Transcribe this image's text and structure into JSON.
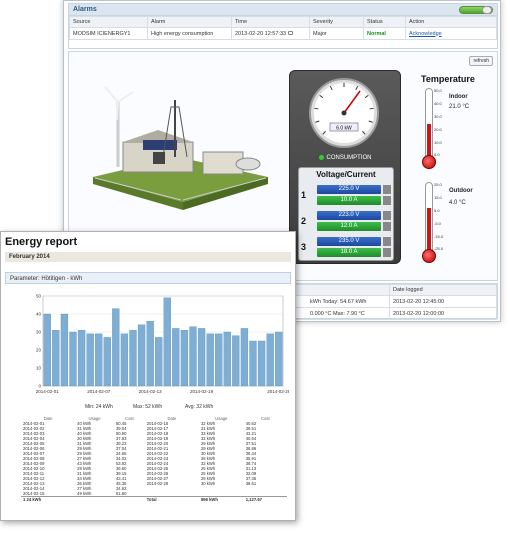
{
  "alarms": {
    "title": "Alarms",
    "columns": [
      "Source",
      "Alarm",
      "Time",
      "Severity",
      "Status",
      "Action"
    ],
    "row": {
      "source": "MODSIM ICIENERGY1",
      "alarm": "High energy consumption",
      "time": "2013-02-20 12:57:33",
      "severity": "Major",
      "status": "Normal",
      "action": "Acknowledge"
    }
  },
  "plant": {
    "refresh_label": "refresh",
    "gauge_reading": "6.0 kW",
    "consumption_label": "CONSUMPTION",
    "vc_title": "Voltage/Current",
    "phases": [
      {
        "n": "1",
        "voltage": "225.0 V",
        "current": "10.0 A"
      },
      {
        "n": "2",
        "voltage": "223.0 V",
        "current": "12.0 A"
      },
      {
        "n": "3",
        "voltage": "235.0 V",
        "current": "18.0 A"
      }
    ],
    "temperature": {
      "title": "Temperature",
      "indoor_label": "Indoor",
      "indoor_value": "21.0 °C",
      "indoor_level": 21.0,
      "outdoor_label": "Outdoor",
      "outdoor_value": "4.0 °C",
      "outdoor_level": 4.0,
      "indoor_ticks": [
        "50.0",
        "40.0",
        "30.0",
        "20.0",
        "10.0",
        "0.0"
      ],
      "outdoor_ticks": [
        "25.0",
        "15.0",
        "5.0",
        "-5.0",
        "-15.0",
        "-25.0"
      ]
    }
  },
  "logs": {
    "columns": [
      "",
      "Date logged"
    ],
    "rows": [
      {
        "value": "kWh Today: 54.67 kWh",
        "date": "2013-02-20 12:45:00"
      },
      {
        "value": "0.000 °C  Max: 7.90 °C",
        "date": "2013-02-20 12:00:00"
      }
    ]
  },
  "report": {
    "title": "Energy report",
    "subtitle": "February 2014",
    "parameter": "Parameter: Hötitigen - kWh",
    "stats": {
      "min": "Min:  24 kWh",
      "max": "Max:  52 kWh",
      "avg": "Avg:  32 kWh"
    },
    "table_headers": [
      "Date",
      "Usage",
      "Cost",
      "Date",
      "Usage",
      "Cost"
    ],
    "rows_left": [
      [
        "2014-02-01",
        "40 kWh",
        "50.45"
      ],
      [
        "2014-02-02",
        "31 kWh",
        "39.04"
      ],
      [
        "2014-02-03",
        "40 kWh",
        "50.90"
      ],
      [
        "2014-02-04",
        "30 kWh",
        "37.93"
      ],
      [
        "2014-02-05",
        "31 kWh",
        "39.23"
      ],
      [
        "2014-02-06",
        "29 kWh",
        "37.04"
      ],
      [
        "2014-02-07",
        "29 kWh",
        "34.65"
      ],
      [
        "2014-02-08",
        "27 kWh",
        "34.02"
      ],
      [
        "2014-02-09",
        "43 kWh",
        "53.92"
      ],
      [
        "2014-02-10",
        "29 kWh",
        "36.60"
      ],
      [
        "2014-02-11",
        "31 kWh",
        "39.15"
      ],
      [
        "2014-02-12",
        "34 kWh",
        "43.41"
      ],
      [
        "2014-02-13",
        "36 kWh",
        "45.36"
      ],
      [
        "2014-02-14",
        "27 kWh",
        "34.62"
      ],
      [
        "2014-02-15",
        "49 kWh",
        "61.60"
      ]
    ],
    "rows_right": [
      [
        "2014-02-16",
        "32 kWh",
        "40.62"
      ],
      [
        "2014-02-17",
        "31 kWh",
        "39.51"
      ],
      [
        "2014-02-18",
        "33 kWh",
        "42.21"
      ],
      [
        "2014-02-19",
        "32 kWh",
        "40.64"
      ],
      [
        "2014-02-20",
        "29 kWh",
        "37.51"
      ],
      [
        "2014-02-21",
        "29 kWh",
        "36.86"
      ],
      [
        "2014-02-22",
        "30 kWh",
        "38.44"
      ],
      [
        "2014-02-23",
        "28 kWh",
        "35.91"
      ],
      [
        "2014-02-24",
        "32 kWh",
        "38.74"
      ],
      [
        "2014-02-25",
        "25 kWh",
        "31.13"
      ],
      [
        "2014-02-26",
        "25 kWh",
        "32.09"
      ],
      [
        "2014-02-27",
        "29 kWh",
        "37.35"
      ],
      [
        "2014-02-28",
        "30 kWh",
        "38.61"
      ]
    ],
    "total_row": [
      "1 24 kWh",
      "",
      "",
      "Total",
      "896 kWh",
      "1,127.67"
    ]
  },
  "chart_data": {
    "type": "bar",
    "title": "",
    "xlabel": "",
    "ylabel": "kWh",
    "ylim": [
      0,
      50
    ],
    "yticks": [
      "50",
      "40",
      "30",
      "20",
      "10",
      "0"
    ],
    "xtick_labels": [
      "2014-02-01",
      "2014-02-07",
      "2014-02-13",
      "2014-02-19",
      "2014-02-28"
    ],
    "categories": [
      "02-01",
      "02-02",
      "02-03",
      "02-04",
      "02-05",
      "02-06",
      "02-07",
      "02-08",
      "02-09",
      "02-10",
      "02-11",
      "02-12",
      "02-13",
      "02-14",
      "02-15",
      "02-16",
      "02-17",
      "02-18",
      "02-19",
      "02-20",
      "02-21",
      "02-22",
      "02-23",
      "02-24",
      "02-25",
      "02-26",
      "02-27",
      "02-28"
    ],
    "values": [
      40,
      31,
      40,
      30,
      31,
      29,
      29,
      27,
      43,
      29,
      31,
      34,
      36,
      27,
      49,
      32,
      31,
      33,
      32,
      29,
      29,
      30,
      28,
      32,
      25,
      25,
      29,
      30
    ],
    "colors": {
      "bar": "#7eaed3",
      "bar_edge": "#4f86b8"
    }
  }
}
